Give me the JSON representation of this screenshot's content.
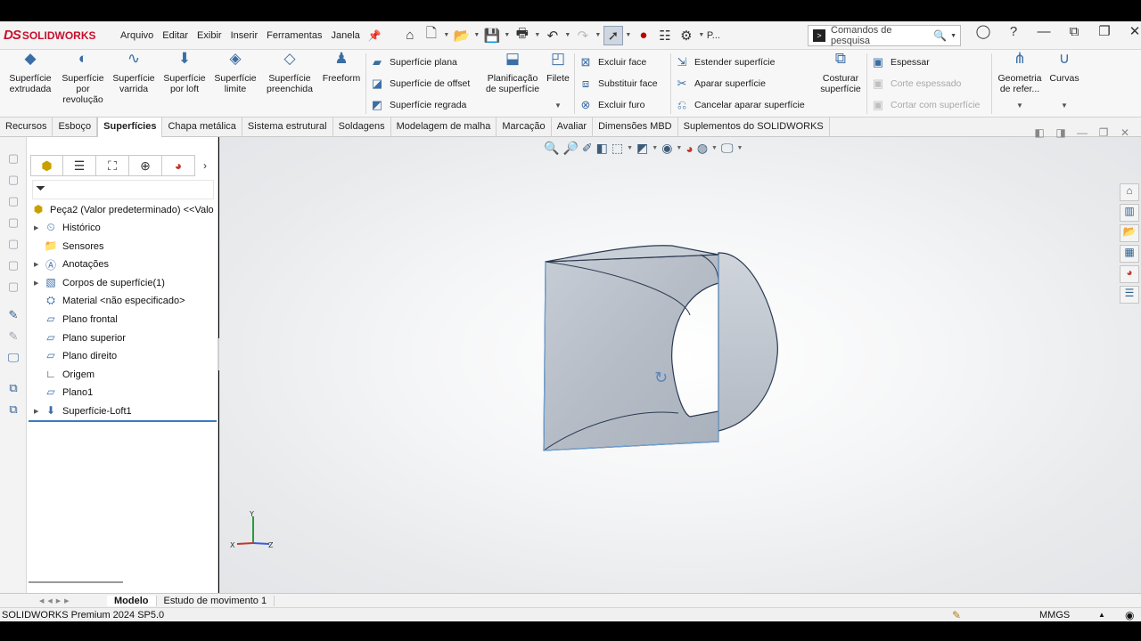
{
  "app": {
    "logo_ds": "DS",
    "logo_name": "SOLIDWORKS"
  },
  "menu": [
    "Arquivo",
    "Editar",
    "Exibir",
    "Inserir",
    "Ferramentas",
    "Janela"
  ],
  "toolbar": {
    "p_label": "P...",
    "search_placeholder": "Comandos de pesquisa"
  },
  "ribbon": {
    "big": [
      {
        "label": "Superfície extrudada",
        "icon": "extruded-surface-icon"
      },
      {
        "label": "Superfície por revolução",
        "icon": "revolved-surface-icon"
      },
      {
        "label": "Superfície varrida",
        "icon": "swept-surface-icon"
      },
      {
        "label": "Superfície por loft",
        "icon": "lofted-surface-icon"
      },
      {
        "label": "Superfície limite",
        "icon": "boundary-surface-icon"
      },
      {
        "label": "Superfície preenchida",
        "icon": "filled-surface-icon"
      },
      {
        "label": "Freeform",
        "icon": "freeform-icon"
      }
    ],
    "col1": [
      "Superfície plana",
      "Superfície de offset",
      "Superfície regrada"
    ],
    "flatten": "Planificação de superfície",
    "fillet": "Filete",
    "col2": [
      "Excluir face",
      "Substituir face",
      "Excluir furo"
    ],
    "col3": [
      "Estender superfície",
      "Aparar superfície",
      "Cancelar aparar superfície"
    ],
    "knit": "Costurar superfície",
    "col4": [
      "Espessar",
      "Corte espessado",
      "Cortar com superfície"
    ],
    "refgeo": "Geometria de refer...",
    "curves": "Curvas"
  },
  "tabs": [
    "Recursos",
    "Esboço",
    "Superfícies",
    "Chapa metálica",
    "Sistema estrutural",
    "Soldagens",
    "Modelagem de malha",
    "Marcação",
    "Avaliar",
    "Dimensões MBD",
    "Suplementos do SOLIDWORKS"
  ],
  "active_tab": "Superfícies",
  "tree": {
    "root": "Peça2 (Valor predeterminado) <<Valo",
    "items": [
      {
        "label": "Histórico",
        "expandable": true
      },
      {
        "label": "Sensores",
        "expandable": false
      },
      {
        "label": "Anotações",
        "expandable": true
      },
      {
        "label": "Corpos de superfície(1)",
        "expandable": true
      },
      {
        "label": "Material <não especificado>",
        "expandable": false
      },
      {
        "label": "Plano frontal",
        "expandable": false
      },
      {
        "label": "Plano superior",
        "expandable": false
      },
      {
        "label": "Plano direito",
        "expandable": false
      },
      {
        "label": "Origem",
        "expandable": false
      },
      {
        "label": "Plano1",
        "expandable": false
      },
      {
        "label": "Superfície-Loft1",
        "expandable": true
      }
    ]
  },
  "triad": {
    "x": "X",
    "y": "Y",
    "z": "Z"
  },
  "bottom_tabs": [
    "Modelo",
    "Estudo de movimento 1"
  ],
  "status": {
    "version": "SOLIDWORKS Premium 2024 SP5.0",
    "units": "MMGS"
  },
  "colors": {
    "brand": "#c8102e",
    "model_fill": "#b9c0c9",
    "model_edge": "#2b3a52"
  }
}
